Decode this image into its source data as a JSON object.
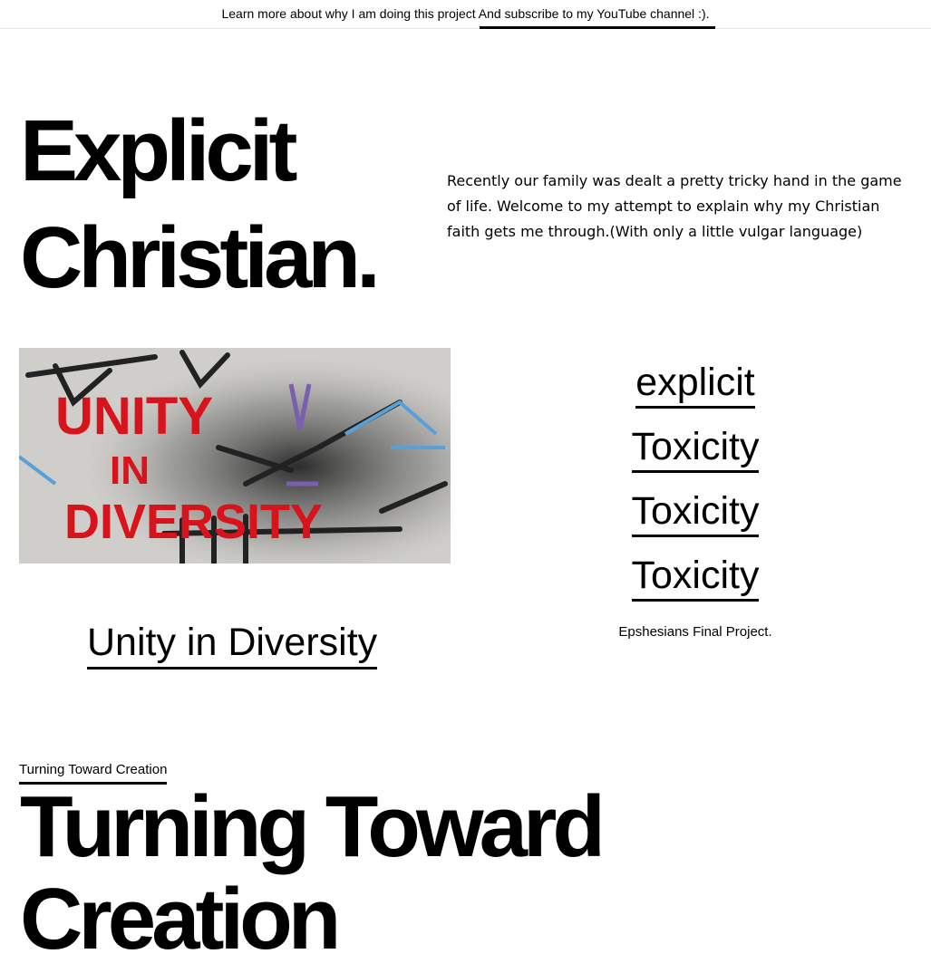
{
  "topbar": {
    "text": "Learn more about why I am doing this project And subscribe to my YouTube channel :)."
  },
  "hero": {
    "title_line1": "Explicit",
    "title_line2": "Christian.",
    "intro": "Recently our family was dealt a pretty tricky hand in the game of life. Welcome to my attempt to explain why my Christian faith gets me through.(With only a little vulgar language)"
  },
  "feature": {
    "graffiti_line1": "UNITY",
    "graffiti_line2": "IN",
    "graffiti_line3": "DIVERSITY",
    "post_title": "Unity in Diversity"
  },
  "tags": {
    "items": [
      "explicit",
      "Toxicity",
      "Toxicity",
      "Toxicity"
    ],
    "caption": "Epshesians Final Project."
  },
  "section": {
    "label": "Turning Toward Creation",
    "title_line1": "Turning Toward",
    "title_line2": "Creation"
  },
  "colors": {
    "text": "#000000",
    "background": "#ffffff",
    "graffiti_red": "#d7131c"
  }
}
